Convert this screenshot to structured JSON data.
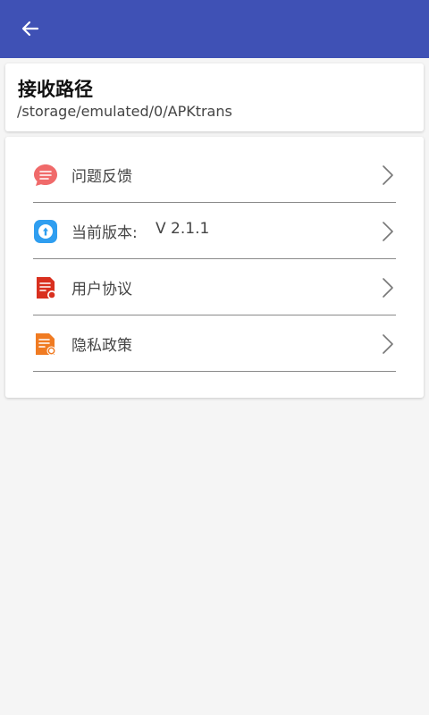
{
  "colors": {
    "app_bar": "#3f51b5",
    "background": "#f5f5f5",
    "card": "#ffffff",
    "text_primary": "#111111",
    "text_secondary": "#444444",
    "divider": "#8a8a8a"
  },
  "app_bar": {
    "back_icon": "arrow-left-icon"
  },
  "receive_path": {
    "title": "接收路径",
    "value": "/storage/emulated/0/APKtrans"
  },
  "menu": {
    "items": [
      {
        "label": "问题反馈",
        "icon": "feedback-icon",
        "icon_color": "#f06a6a",
        "chevron": "chevron-right-icon"
      },
      {
        "label": "当前版本:",
        "value": "V 2.1.1",
        "icon": "version-icon",
        "icon_color": "#2f9ef0",
        "chevron": "chevron-right-icon"
      },
      {
        "label": "用户协议",
        "icon": "agreement-icon",
        "icon_color": "#d9301f",
        "chevron": "chevron-right-icon"
      },
      {
        "label": "隐私政策",
        "icon": "privacy-icon",
        "icon_color": "#f07b22",
        "chevron": "chevron-right-icon"
      }
    ]
  }
}
